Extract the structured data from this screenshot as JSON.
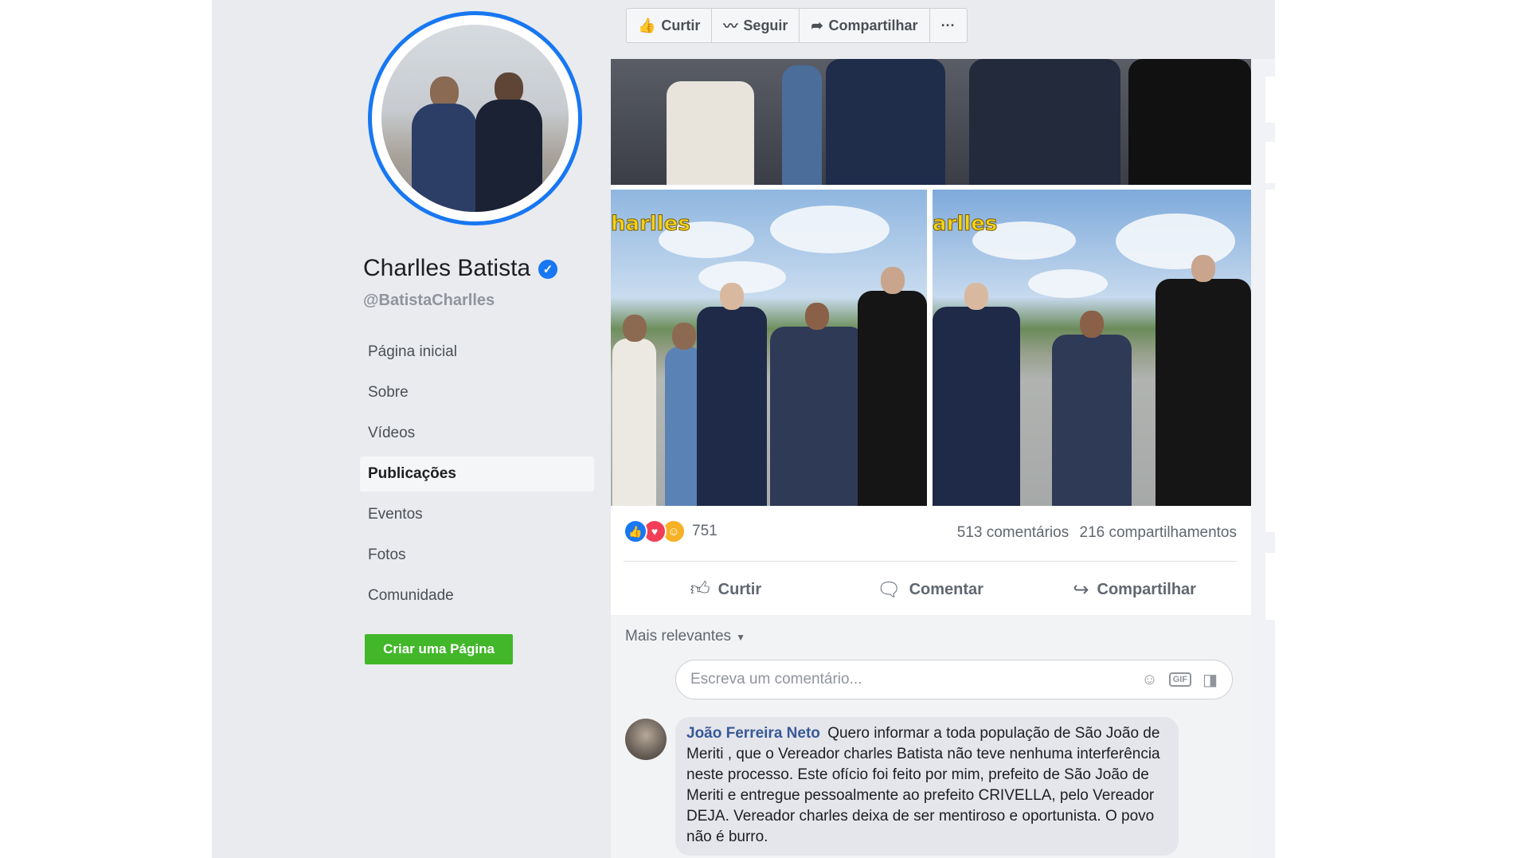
{
  "page": {
    "name": "Charlles Batista",
    "handle": "@BatistaCharlles",
    "verified": true
  },
  "sidebar": {
    "items": [
      {
        "label": "Página inicial",
        "active": false
      },
      {
        "label": "Sobre",
        "active": false
      },
      {
        "label": "Vídeos",
        "active": false
      },
      {
        "label": "Publicações",
        "active": true
      },
      {
        "label": "Eventos",
        "active": false
      },
      {
        "label": "Fotos",
        "active": false
      },
      {
        "label": "Comunidade",
        "active": false
      }
    ],
    "create_page_label": "Criar uma Página"
  },
  "top_actions": {
    "like_label": "Curtir",
    "follow_label": "Seguir",
    "share_label": "Compartilhar",
    "more_label": "···"
  },
  "post": {
    "photo_logo_left": "harlles",
    "photo_logo_right": "arlles",
    "reactions_count": "751",
    "comments_count": "513 comentários",
    "shares_count": "216 compartilhamentos",
    "actions": {
      "like": "Curtir",
      "comment": "Comentar",
      "share": "Compartilhar"
    }
  },
  "comments": {
    "sort_label": "Mais relevantes",
    "input_placeholder": "Escreva um comentário...",
    "input_gif_label": "GIF",
    "items": [
      {
        "author": "João Ferreira Neto",
        "text": "Quero informar a toda população de São João de Meriti , que o Vereador charles Batista não teve nenhuma interferência neste processo. Este ofício foi feito por mim, prefeito de São João de Meriti e entregue pessoalmente ao prefeito CRIVELLA, pelo Vereador DEJA. Vereador charles deixa de ser mentiroso e oportunista. O povo não é burro."
      }
    ]
  },
  "colors": {
    "brand_blue": "#1877f2",
    "create_green": "#42b72a",
    "link_blue": "#385898"
  }
}
